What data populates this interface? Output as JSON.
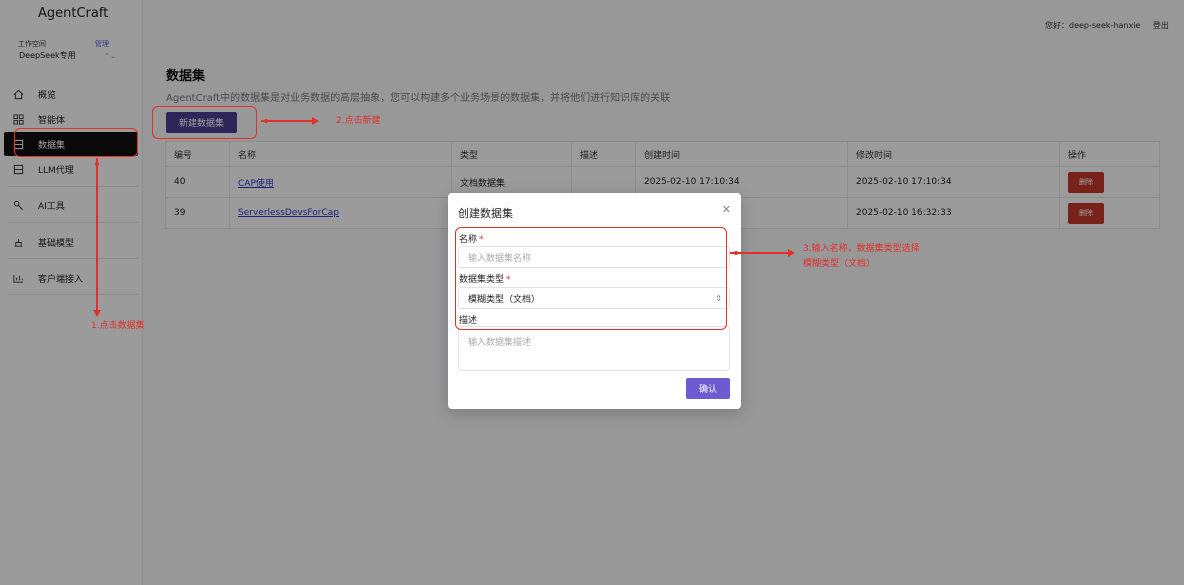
{
  "sidebar": {
    "brand": "AgentCraft",
    "workspace_label": "工作空间",
    "workspace_manage": "管理",
    "workspace_value": "DeepSeek专用",
    "items": [
      {
        "label": "概览",
        "icon": "home-icon"
      },
      {
        "label": "智能体",
        "icon": "apps-icon"
      },
      {
        "label": "数据集",
        "icon": "database-icon"
      },
      {
        "label": "LLM代理",
        "icon": "proxy-icon"
      },
      {
        "label": "AI工具",
        "icon": "tool-icon"
      },
      {
        "label": "基础模型",
        "icon": "model-icon"
      },
      {
        "label": "客户端接入",
        "icon": "client-icon"
      }
    ]
  },
  "topbar": {
    "greeting": "您好：deep-seek-hanxie",
    "logout": "登出"
  },
  "main": {
    "title": "数据集",
    "description": "AgentCraft中的数据集是对业务数据的高层抽象，您可以构建多个业务场景的数据集，并将他们进行知识库的关联",
    "new_button": "新建数据集",
    "table": {
      "headers": [
        "编号",
        "名称",
        "类型",
        "描述",
        "创建时间",
        "修改时间",
        "操作"
      ],
      "rows": [
        {
          "id": "40",
          "name": "CAP使用",
          "type": "文档数据集",
          "desc": "",
          "created": "2025-02-10 17:10:34",
          "modified": "2025-02-10 17:10:34",
          "action": "删除"
        },
        {
          "id": "39",
          "name": "ServerlessDevsForCap",
          "type": "",
          "desc": "",
          "created": "",
          "modified": "2025-02-10 16:32:33",
          "action": "删除"
        }
      ]
    }
  },
  "modal": {
    "title": "创建数据集",
    "name_label": "名称",
    "name_placeholder": "输入数据集名称",
    "type_label": "数据集类型",
    "type_value": "模糊类型（文档）",
    "desc_label": "描述",
    "desc_placeholder": "输入数据集描述",
    "confirm": "确认"
  },
  "annotations": {
    "step1": "1.点击数据集",
    "step2": "2.点击新建",
    "step3_line1": "3.输入名称，数据集类型选择",
    "step3_line2": "模糊类型（文档）"
  },
  "colors": {
    "accent": "#4b3c8f",
    "confirm": "#6f5bd1",
    "annotation": "#e3302a",
    "delete": "#c0392b"
  }
}
